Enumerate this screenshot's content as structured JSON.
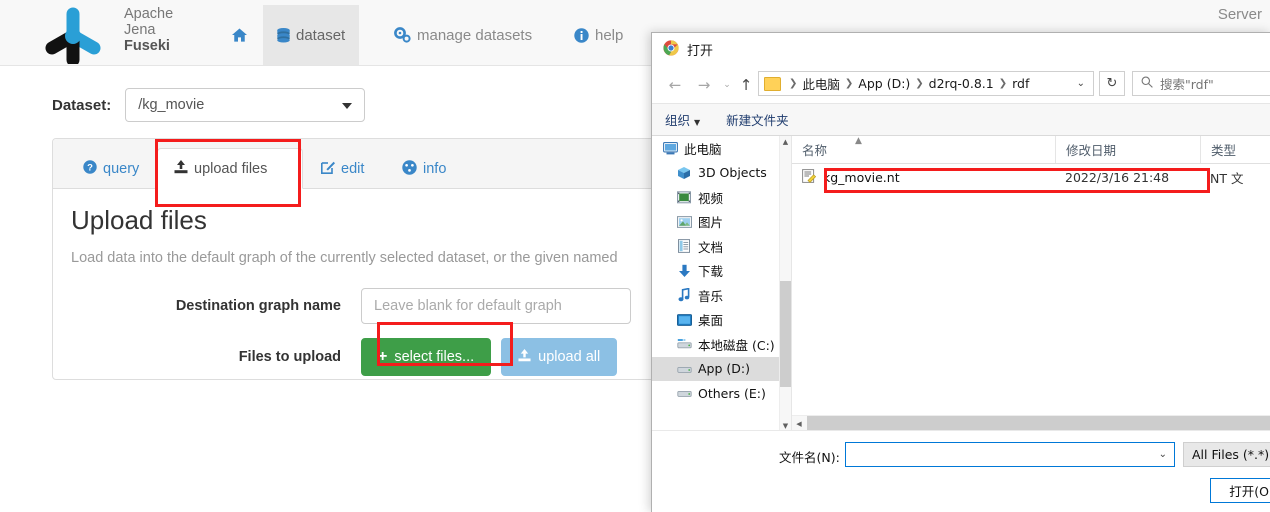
{
  "fuseki": {
    "brand": {
      "line1": "Apache",
      "line2": "Jena",
      "line3": "Fuseki"
    },
    "nav": [
      {
        "label": "",
        "icon": "home-icon",
        "active": false
      },
      {
        "label": "dataset",
        "icon": "database-icon",
        "active": true
      },
      {
        "label": "manage datasets",
        "icon": "gears-icon",
        "active": false
      },
      {
        "label": "help",
        "icon": "info-icon",
        "active": false
      }
    ],
    "server_label": "Server",
    "dataset": {
      "label": "Dataset:",
      "value": "/kg_movie"
    },
    "panel_tabs": [
      {
        "label": "query",
        "icon": "question-icon",
        "active": false
      },
      {
        "label": "upload files",
        "icon": "upload-icon",
        "active": true
      },
      {
        "label": "edit",
        "icon": "edit-icon",
        "active": false
      },
      {
        "label": "info",
        "icon": "dashboard-icon",
        "active": false
      }
    ],
    "upload": {
      "title": "Upload files",
      "description": "Load data into the default graph of the currently selected dataset, or the given named",
      "graph_label": "Destination graph name",
      "graph_placeholder": "Leave blank for default graph",
      "files_label": "Files to upload",
      "select_files_button": "select files...",
      "upload_all_button": "upload all"
    },
    "colors": {
      "green": "#3e9e48",
      "blue": "#8cc0e4",
      "link": "#3a87c8",
      "highlight": "#f41c1c"
    }
  },
  "dialog": {
    "title": "打开",
    "address": {
      "crumbs": [
        "此电脑",
        "App (D:)",
        "d2rq-0.8.1",
        "rdf"
      ],
      "search_placeholder": "搜索\"rdf\""
    },
    "toolbar": [
      {
        "label": "组织",
        "has_caret": true
      },
      {
        "label": "新建文件夹",
        "has_caret": false
      }
    ],
    "sidebar": [
      {
        "label": "此电脑",
        "icon": "computer-icon",
        "indent": false,
        "selected": false
      },
      {
        "label": "3D Objects",
        "icon": "3d-objects-icon",
        "indent": true,
        "selected": false
      },
      {
        "label": "视频",
        "icon": "videos-icon",
        "indent": true,
        "selected": false
      },
      {
        "label": "图片",
        "icon": "pictures-icon",
        "indent": true,
        "selected": false
      },
      {
        "label": "文档",
        "icon": "documents-icon",
        "indent": true,
        "selected": false
      },
      {
        "label": "下载",
        "icon": "downloads-icon",
        "indent": true,
        "selected": false
      },
      {
        "label": "音乐",
        "icon": "music-icon",
        "indent": true,
        "selected": false
      },
      {
        "label": "桌面",
        "icon": "desktop-icon",
        "indent": true,
        "selected": false
      },
      {
        "label": "本地磁盘 (C:)",
        "icon": "drive-icon",
        "indent": true,
        "selected": false
      },
      {
        "label": "App (D:)",
        "icon": "drive-icon",
        "indent": true,
        "selected": true
      },
      {
        "label": "Others (E:)",
        "icon": "drive-icon",
        "indent": true,
        "selected": false
      }
    ],
    "columns": [
      {
        "label": "名称",
        "sorted": true
      },
      {
        "label": "修改日期",
        "sorted": false
      },
      {
        "label": "类型",
        "sorted": false
      }
    ],
    "files": [
      {
        "name": "kg_movie.nt",
        "modified": "2022/3/16 21:48",
        "type": "NT 文",
        "icon": "nt-file-icon"
      }
    ],
    "footer": {
      "filename_label": "文件名(N):",
      "filename_value": "",
      "filter_value": "All Files (*.*)",
      "open_button": "打开(O)"
    }
  }
}
